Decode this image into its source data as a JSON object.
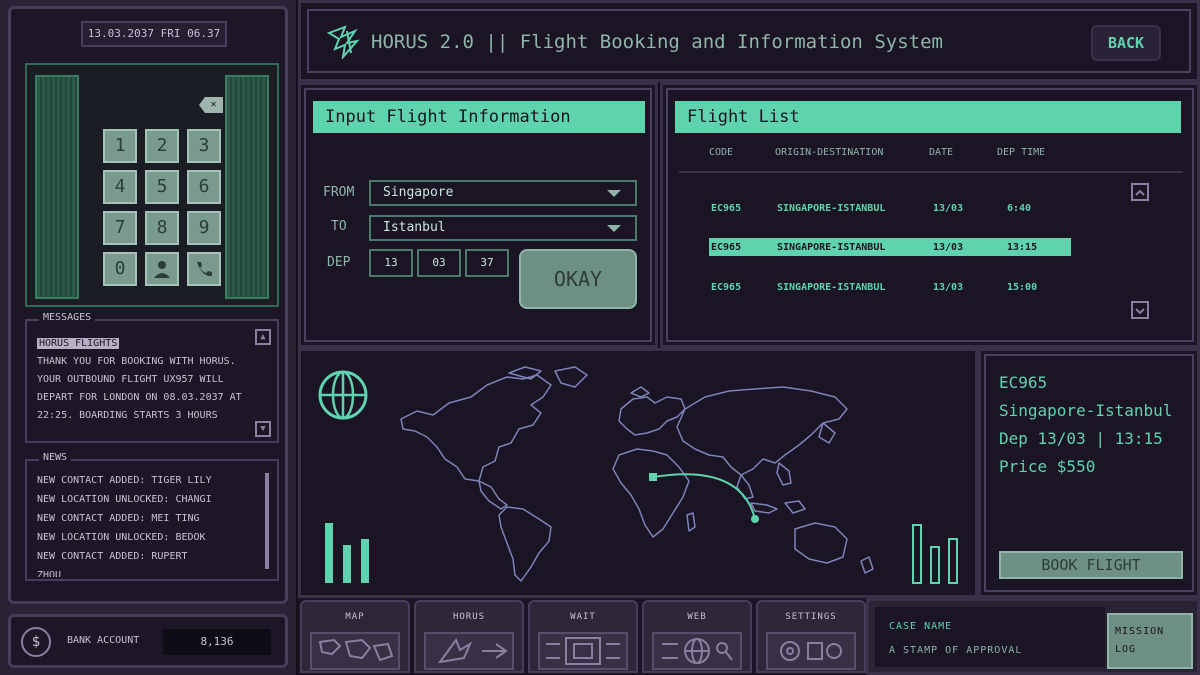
{
  "phone": {
    "datetime": "13.03.2037 FRI 06.37",
    "keys": [
      "1",
      "2",
      "3",
      "4",
      "5",
      "6",
      "7",
      "8",
      "9",
      "0"
    ],
    "messages": {
      "title": "MESSAGES",
      "sender": "HORUS FLIGHTS",
      "body": "THANK YOU FOR BOOKING WITH HORUS. YOUR OUTBOUND FLIGHT UX957 WILL DEPART FOR LONDON ON 08.03.2037 AT 22:25. BOARDING STARTS 3 HOURS"
    },
    "news": {
      "title": "NEWS",
      "items": [
        "NEW CONTACT ADDED: TIGER LILY",
        "NEW LOCATION UNLOCKED: CHANGI",
        "NEW CONTACT ADDED: MEI TING",
        "NEW LOCATION UNLOCKED: BEDOK",
        "NEW CONTACT ADDED: RUPERT",
        "ZHOU"
      ]
    },
    "bank": {
      "label": "BANK ACCOUNT",
      "value": "8,136",
      "icon": "dollar-icon"
    }
  },
  "header": {
    "title": "HORUS 2.0 || Flight Booking and Information System",
    "back_label": "BACK"
  },
  "input": {
    "title": "Input Flight Information",
    "from_label": "FROM",
    "from_value": "Singapore",
    "to_label": "TO",
    "to_value": "Istanbul",
    "dep_label": "DEP",
    "dep_day": "13",
    "dep_month": "03",
    "dep_year": "37",
    "okay_label": "OKAY"
  },
  "flight_list": {
    "title": "Flight List",
    "columns": [
      "CODE",
      "ORIGIN-DESTINATION",
      "DATE",
      "DEP TIME"
    ],
    "rows": [
      {
        "code": "EC965",
        "route": "SINGAPORE-ISTANBUL",
        "date": "13/03",
        "time": "6:40"
      },
      {
        "code": "EC965",
        "route": "SINGAPORE-ISTANBUL",
        "date": "13/03",
        "time": "13:15"
      },
      {
        "code": "EC965",
        "route": "SINGAPORE-ISTANBUL",
        "date": "13/03",
        "time": "15:00"
      }
    ],
    "selected_row": 1
  },
  "details": {
    "code": "EC965",
    "route": "Singapore-Istanbul",
    "dep": "Dep 13/03 | 13:15",
    "price": "Price $550",
    "book_label": "BOOK FLIGHT"
  },
  "nav": {
    "tabs": [
      "MAP",
      "HORUS",
      "WAIT",
      "WEB",
      "SETTINGS"
    ]
  },
  "mission": {
    "case_label": "CASE NAME",
    "case_value": "A STAMP OF APPROVAL",
    "log_label": "MISSION LOG"
  },
  "colors": {
    "accent": "#5fd3ad",
    "panel": "#1a1424",
    "border": "#3a3048",
    "muted": "#8fb5a8"
  }
}
